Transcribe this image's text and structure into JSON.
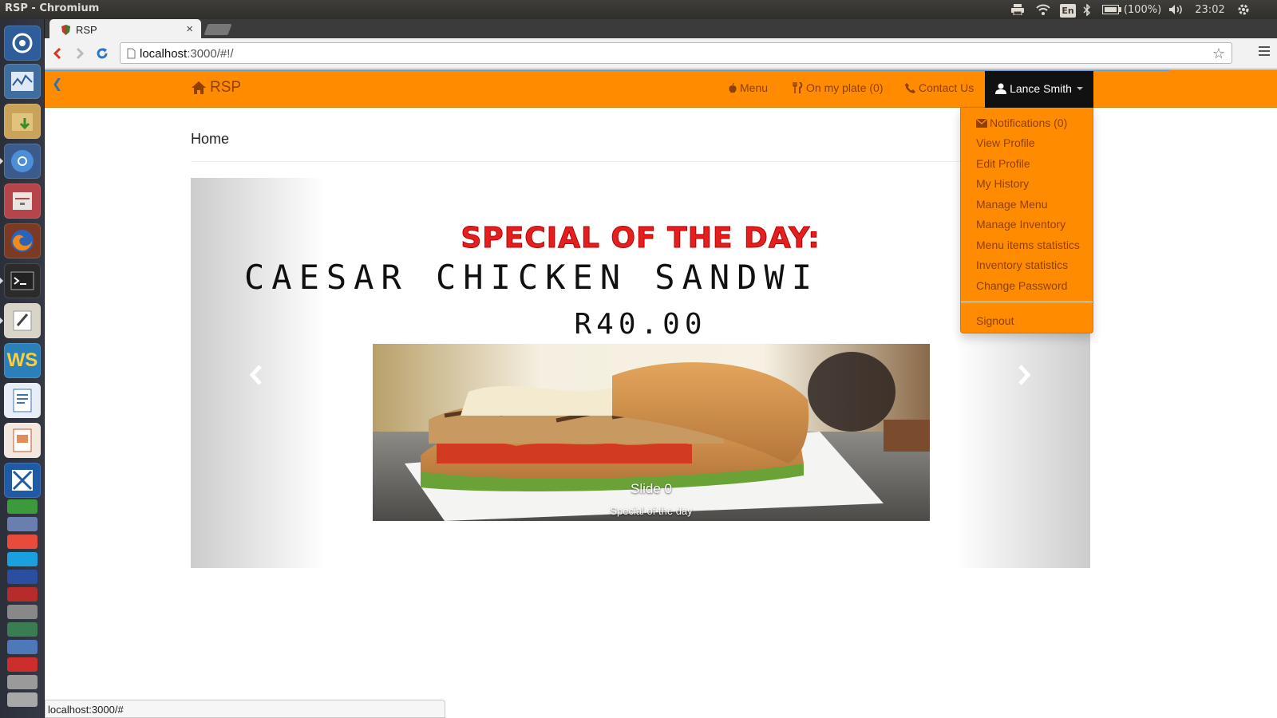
{
  "os": {
    "window_title": "RSP - Chromium",
    "keyboard_layout": "En",
    "battery": "(100%)",
    "clock": "23:02"
  },
  "browser": {
    "tab_title": "RSP",
    "url_host": "localhost",
    "url_rest": ":3000/#!/",
    "status_url": "localhost:3000/#"
  },
  "navbar": {
    "brand": "RSP",
    "menu_label": "Menu",
    "plate_label": "On my plate (0)",
    "contact_label": "Contact Us",
    "user_name": "Lance Smith",
    "accent_color": "#ff8c00"
  },
  "dropdown": {
    "items": [
      "Notifications (0)",
      "View Profile",
      "Edit Profile",
      "My History",
      "Manage Menu",
      "Manage Inventory",
      "Menu items statistics",
      "Inventory statistics",
      "Change Password"
    ],
    "signout": "Signout"
  },
  "main": {
    "heading": "Home",
    "carousel": {
      "special_title": "SPECIAL OF THE DAY:",
      "special_item": "CAESAR CHICKEN SANDWI",
      "special_price": "R40.00",
      "caption_title": "Slide 0",
      "caption_text": "Special of the day"
    }
  }
}
